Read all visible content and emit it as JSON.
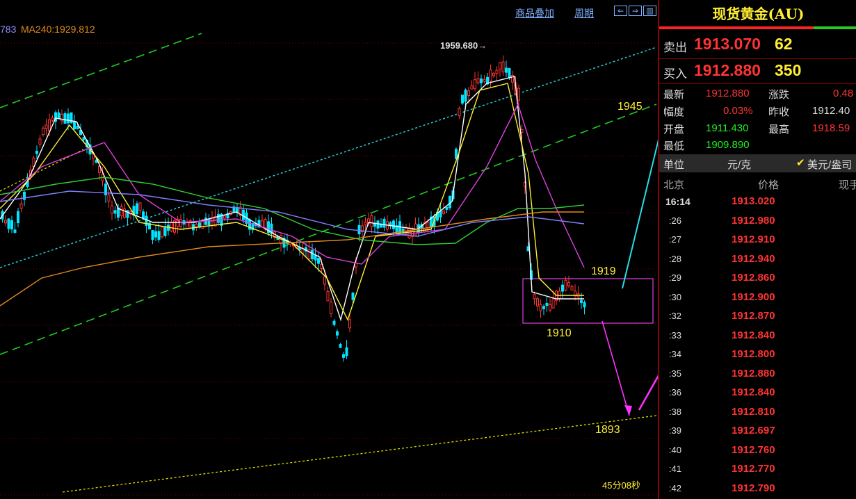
{
  "toolbar": {
    "overlay_label": "商品叠加",
    "period_label": "周期",
    "nav_icons": [
      "arrow-left-icon",
      "arrow-right-icon",
      "window-icon"
    ],
    "nav_glyphs": [
      "⇐",
      "⇒",
      "▥"
    ]
  },
  "indicators": {
    "ma_prev_value": "783",
    "ma240_label": "MA240:1929.812"
  },
  "annotations": {
    "peak_label": "1959.680→",
    "level_1945": "1945",
    "level_1919": "1919",
    "level_1910": "1910",
    "level_1893": "1893",
    "timer": "45分08秒"
  },
  "colors": {
    "up": "#ff3333",
    "down": "#00e5ff",
    "ma_white": "#ffffff",
    "ma_yellow": "#ffee33",
    "ma_magenta": "#e040e0",
    "ma_green": "#33cc33",
    "ma_orange": "#e08a1e",
    "ma_blue": "#8080ff",
    "channel_green": "#22cc22",
    "channel_cyan": "#22ccdd",
    "channel_yellow": "#dddd00",
    "arrow_cyan": "#22e0e8",
    "arrow_magenta": "#ff33ff"
  },
  "quote": {
    "title": "现货黄金(AU)",
    "sell_label": "卖出",
    "sell_price": "1913.070",
    "sell_volume": "62",
    "buy_label": "买入",
    "buy_price": "1912.880",
    "buy_volume": "350",
    "stats": {
      "latest_label": "最新",
      "latest_value": "1912.880",
      "change_label": "涨跌",
      "change_value": "0.48",
      "range_label": "幅度",
      "range_value": "0.03%",
      "prev_close_label": "昨收",
      "prev_close_value": "1912.40",
      "open_label": "开盘",
      "open_value": "1911.430",
      "high_label": "最高",
      "high_value": "1918.59",
      "low_label": "最低",
      "low_value": "1909.890"
    },
    "unit_label": "单位",
    "unit_cny": "元/克",
    "unit_usd": "美元/盎司",
    "ticks_header": {
      "time": "北京",
      "price": "价格",
      "volume": "现手"
    },
    "ticks": [
      {
        "time": "16:14",
        "price": "1913.020"
      },
      {
        "time": ":26",
        "price": "1912.980"
      },
      {
        "time": ":27",
        "price": "1912.910"
      },
      {
        "time": ":28",
        "price": "1912.940"
      },
      {
        "time": ":29",
        "price": "1912.860"
      },
      {
        "time": ":30",
        "price": "1912.900"
      },
      {
        "time": ":32",
        "price": "1912.870"
      },
      {
        "time": ":33",
        "price": "1912.840"
      },
      {
        "time": ":34",
        "price": "1912.800"
      },
      {
        "time": ":35",
        "price": "1912.880"
      },
      {
        "time": ":36",
        "price": "1912.840"
      },
      {
        "time": ":38",
        "price": "1912.810"
      },
      {
        "time": ":39",
        "price": "1912.697"
      },
      {
        "time": ":40",
        "price": "1912.760"
      },
      {
        "time": ":41",
        "price": "1912.770"
      },
      {
        "time": ":42",
        "price": "1912.790"
      }
    ]
  }
}
